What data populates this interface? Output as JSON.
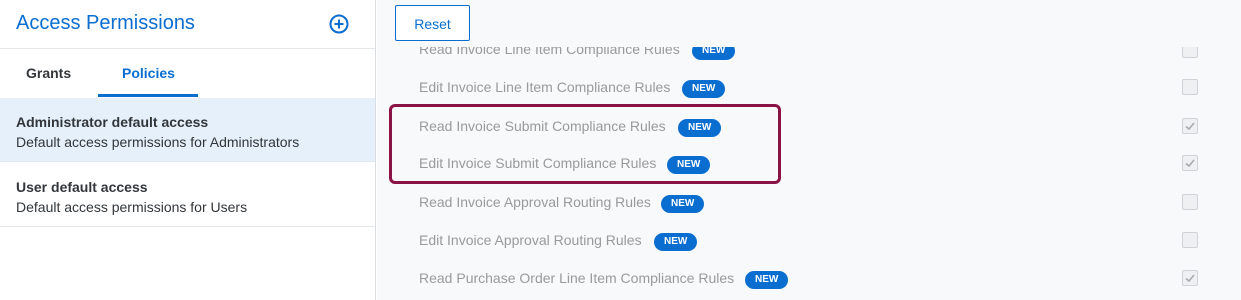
{
  "left": {
    "title": "Access Permissions",
    "add_icon": "add-circle-icon",
    "tabs": [
      "Grants",
      "Policies"
    ],
    "active_tab": "Policies",
    "policies": [
      {
        "title": "Administrator default access",
        "description": "Default access permissions for Administrators",
        "selected": true
      },
      {
        "title": "User default access",
        "description": "Default access permissions for Users",
        "selected": false
      }
    ]
  },
  "toolbar": {
    "reset_label": "Reset"
  },
  "permissions": [
    {
      "label": "Read Invoice Line Item Compliance Rules",
      "badge": "NEW",
      "checked": false
    },
    {
      "label": "Edit Invoice Line Item Compliance Rules",
      "badge": "NEW",
      "checked": false
    },
    {
      "label": "Read Invoice Submit Compliance Rules",
      "badge": "NEW",
      "checked": true
    },
    {
      "label": "Edit Invoice Submit Compliance Rules",
      "badge": "NEW",
      "checked": true
    },
    {
      "label": "Read Invoice Approval Routing Rules",
      "badge": "NEW",
      "checked": false
    },
    {
      "label": "Edit Invoice Approval Routing Rules",
      "badge": "NEW",
      "checked": false
    },
    {
      "label": "Read Purchase Order Line Item Compliance Rules",
      "badge": "NEW",
      "checked": true
    }
  ],
  "colors": {
    "accent": "#0a6ed1",
    "highlight": "#8b1245",
    "muted_text": "#9a9a9a"
  }
}
